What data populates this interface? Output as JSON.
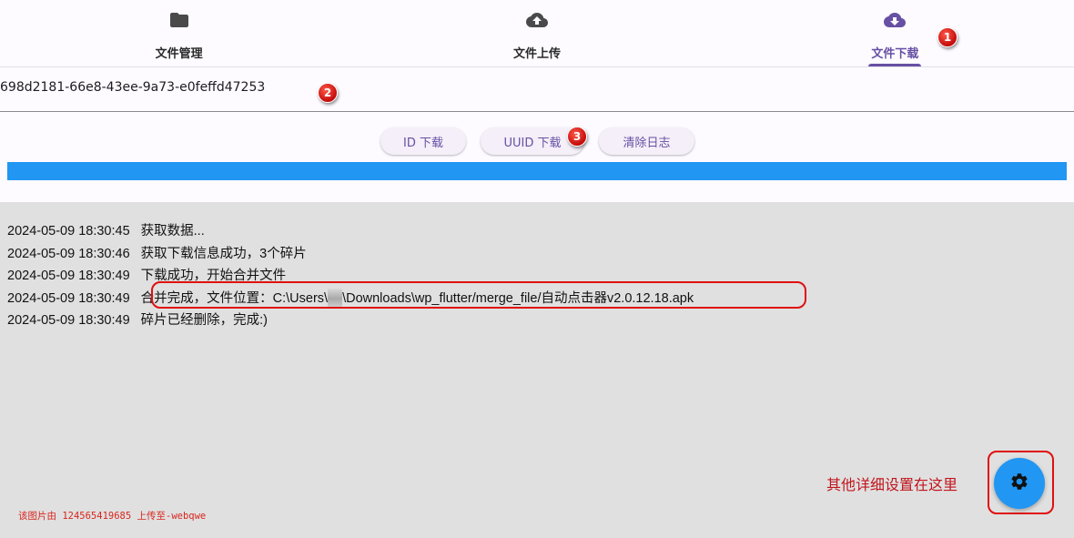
{
  "tabs": [
    {
      "label": "文件管理",
      "icon": "folder-icon",
      "active": false
    },
    {
      "label": "文件上传",
      "icon": "cloud-upload-icon",
      "active": false
    },
    {
      "label": "文件下载",
      "icon": "cloud-download-icon",
      "active": true
    }
  ],
  "input": {
    "value": "698d2181-66e8-43ee-9a73-e0feffd47253"
  },
  "buttons": {
    "id_download": "ID 下载",
    "uuid_download": "UUID 下载",
    "clear_log": "清除日志"
  },
  "progress": {
    "value": 1.0
  },
  "log": [
    {
      "time": "2024-05-09 18:30:45",
      "msg": "获取数据..."
    },
    {
      "time": "2024-05-09 18:30:46",
      "msg": "获取下载信息成功，3个碎片"
    },
    {
      "time": "2024-05-09 18:30:49",
      "msg": "下载成功，开始合并文件"
    },
    {
      "time": "2024-05-09 18:30:49",
      "msg_before": "合并完成，文件位置：C:\\Users\\",
      "msg_after": "\\Downloads\\wp_flutter/merge_file/自动点击器v2.0.12.18.apk"
    },
    {
      "time": "2024-05-09 18:30:49",
      "msg": "碎片已经删除，完成:)"
    }
  ],
  "annotations": {
    "markers": [
      "1",
      "2",
      "3"
    ],
    "note": "其他详细设置在这里",
    "watermark": "该图片由 124565419685 上传至-webqwe"
  },
  "fab": {
    "icon": "settings-gear-icon"
  },
  "colors": {
    "accent": "#6750a4",
    "progress": "#2196f3",
    "fab": "#2196f3",
    "annotation": "#e01010",
    "log_bg": "#e0e0e0"
  }
}
